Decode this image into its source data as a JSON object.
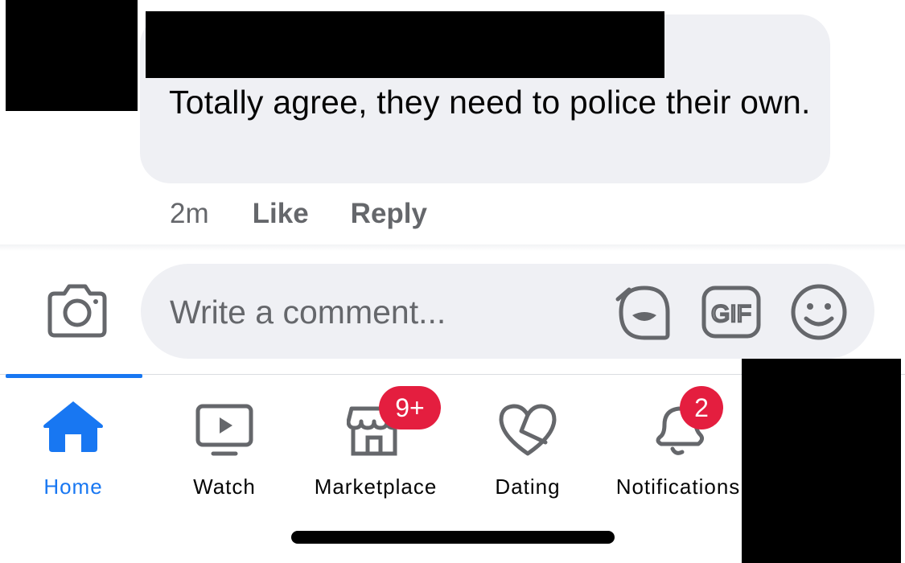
{
  "comment": {
    "text": "Totally agree, they need to police their own.",
    "time": "2m",
    "like_label": "Like",
    "reply_label": "Reply"
  },
  "composer": {
    "placeholder": "Write a comment...",
    "icons": [
      "camera-icon",
      "sticker-icon",
      "gif-icon",
      "emoji-icon"
    ],
    "gif_label": "GIF"
  },
  "tabs": [
    {
      "label": "Home",
      "icon": "home-icon",
      "active": true
    },
    {
      "label": "Watch",
      "icon": "watch-icon"
    },
    {
      "label": "Marketplace",
      "icon": "marketplace-icon",
      "badge": "9+"
    },
    {
      "label": "Dating",
      "icon": "heart-icon"
    },
    {
      "label": "Notifications",
      "icon": "bell-icon",
      "badge": "2"
    }
  ],
  "colors": {
    "accent": "#1877f2",
    "badge": "#e41e3f",
    "bubble": "#eff0f4",
    "muted": "#65676b"
  }
}
